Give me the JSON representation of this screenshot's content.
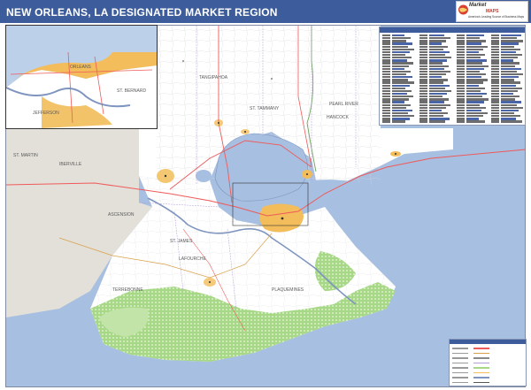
{
  "header": {
    "title": "NEW ORLEANS, LA DESIGNATED MARKET REGION"
  },
  "brand": {
    "name": "Market",
    "name_accent": "MAPS",
    "tagline": "America's Leading Source of Business Maps"
  },
  "colors": {
    "header": "#3d5c9b",
    "water": "#a7bfe0",
    "land": "#ffffff",
    "outside_region": "#e3e0d9",
    "urban": "#f2bd5a",
    "marsh": "#a7d885",
    "interstate": "#ef5a5a",
    "highway": "#d9a04a"
  },
  "map": {
    "places": [
      "ST. MARTIN",
      "IBERVILLE",
      "ASCENSION",
      "ST. JAMES",
      "LAFOURCHE",
      "TERREBONNE",
      "HANCOCK",
      "PEARL RIVER",
      "TANGIPAHOA",
      "ST. TAMMANY",
      "PLAQUEMINES"
    ],
    "inset_places": [
      "ORLEANS",
      "JEFFERSON",
      "ST. BERNARD"
    ]
  }
}
